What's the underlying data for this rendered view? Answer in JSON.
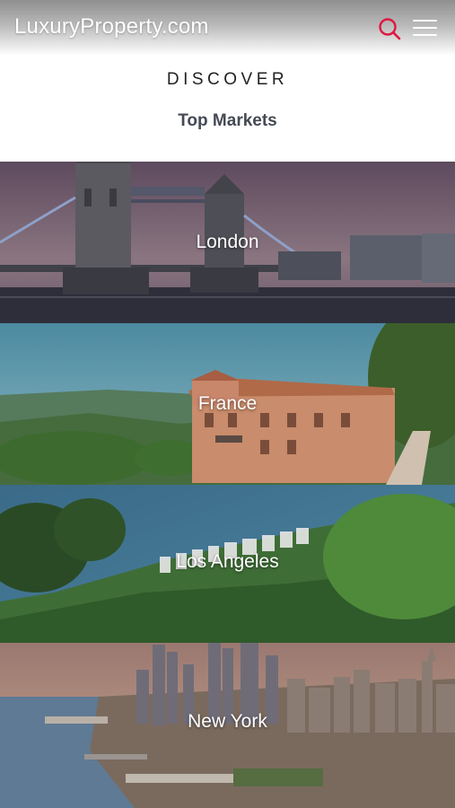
{
  "header": {
    "logo": "LuxuryProperty.com",
    "search_icon": "search-icon",
    "menu_icon": "hamburger-menu-icon",
    "accent_color": "#e0163f"
  },
  "intro": {
    "eyebrow": "DISCOVER",
    "heading": "Top Markets"
  },
  "markets": [
    {
      "label": "London"
    },
    {
      "label": "France"
    },
    {
      "label": "Los Angeles"
    },
    {
      "label": "New York"
    }
  ]
}
